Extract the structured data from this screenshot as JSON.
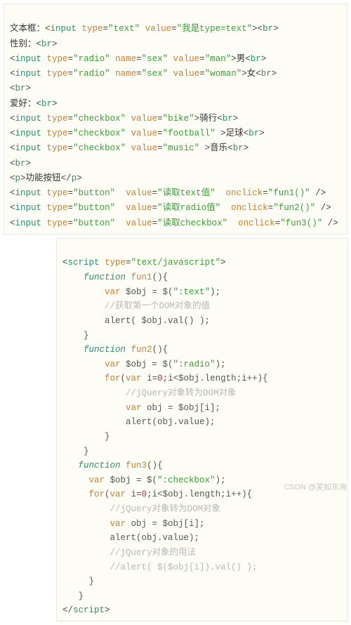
{
  "watermark": "CSDN @芙如东海",
  "b1": {
    "l01": {
      "t1": "文本框：",
      "p1": "<",
      "a1": "input ",
      "an1": "type",
      "eq1": "=",
      "av1": "\"text\"",
      "sp1": " ",
      "an2": "value",
      "eq2": "=",
      "av2": "\"我是type=text\"",
      "p2": "><",
      "a2": "br",
      "p3": ">"
    },
    "l02": {
      "t1": "性别：",
      "p1": "<",
      "a1": "br",
      "p2": ">"
    },
    "l03": {
      "p1": "<",
      "a1": "input ",
      "an1": "type",
      "eq1": "=",
      "av1": "\"radio\"",
      "sp1": " ",
      "an2": "name",
      "eq2": "=",
      "av2": "\"sex\"",
      "sp2": " ",
      "an3": "value",
      "eq3": "=",
      "av3": "\"man\"",
      "p2": ">",
      "t1": "男",
      "p3": "<",
      "a2": "br",
      "p4": ">"
    },
    "l04": {
      "p1": "<",
      "a1": "input ",
      "an1": "type",
      "eq1": "=",
      "av1": "\"radio\"",
      "sp1": " ",
      "an2": "name",
      "eq2": "=",
      "av2": "\"sex\"",
      "sp2": " ",
      "an3": "value",
      "eq3": "=",
      "av3": "\"woman\"",
      "p2": ">",
      "t1": "女",
      "p3": "<",
      "a2": "br",
      "p4": ">"
    },
    "l05": {
      "p1": "<",
      "a1": "br",
      "p2": ">"
    },
    "l06": {
      "t1": "爱好：",
      "p1": "<",
      "a1": "br",
      "p2": ">"
    },
    "l07": {
      "p1": "<",
      "a1": "input ",
      "an1": "type",
      "eq1": "=",
      "av1": "\"checkbox\"",
      "sp1": " ",
      "an2": "value",
      "eq2": "=",
      "av2": "\"bike\"",
      "p2": ">",
      "t1": "骑行",
      "p3": "<",
      "a2": "br",
      "p4": ">"
    },
    "l08": {
      "p1": "<",
      "a1": "input ",
      "an1": "type",
      "eq1": "=",
      "av1": "\"checkbox\"",
      "sp1": " ",
      "an2": "value",
      "eq2": "=",
      "av2": "\"football\"",
      "p2": " >",
      "t1": "足球",
      "p3": "<",
      "a2": "br",
      "p4": ">"
    },
    "l09": {
      "p1": "<",
      "a1": "input ",
      "an1": "type",
      "eq1": "=",
      "av1": "\"checkbox\"",
      "sp1": " ",
      "an2": "value",
      "eq2": "=",
      "av2": "\"music\"",
      "p2": " >",
      "t1": "音乐",
      "p3": "<",
      "a2": "br",
      "p4": ">"
    },
    "l10": {
      "p1": "<",
      "a1": "br",
      "p2": ">"
    },
    "l11": {
      "p1": "<",
      "a1": "p",
      "p2": ">",
      "t1": "功能按钮",
      "p3": "</",
      "a2": "p",
      "p4": ">"
    },
    "l12": {
      "p1": "<",
      "a1": "input ",
      "an1": "type",
      "eq1": "=",
      "av1": "\"button\"",
      "sp1": "  ",
      "an2": "value",
      "eq2": "=",
      "av2": "\"读取text值\"",
      "sp2": "  ",
      "an3": "onclick",
      "eq3": "=",
      "av3": "\"fun1()\"",
      "p2": " />"
    },
    "l13": {
      "p1": "<",
      "a1": "input ",
      "an1": "type",
      "eq1": "=",
      "av1": "\"button\"",
      "sp1": "  ",
      "an2": "value",
      "eq2": "=",
      "av2": "\"读取radio值\"",
      "sp2": "  ",
      "an3": "onclick",
      "eq3": "=",
      "av3": "\"fun2()\"",
      "p2": " />"
    },
    "l14": {
      "p1": "<",
      "a1": "input ",
      "an1": "type",
      "eq1": "=",
      "av1": "\"button\"",
      "sp1": "  ",
      "an2": "value",
      "eq2": "=",
      "av2": "\"读取checkbox\"",
      "sp2": "  ",
      "an3": "onclick",
      "eq3": "=",
      "av3": "\"fun3()\"",
      "p2": " />"
    }
  },
  "b2": {
    "l01": {
      "p1": "<",
      "a1": "script ",
      "an1": "type",
      "eq1": "=",
      "av1": "\"text/javascript\"",
      "p2": ">"
    },
    "l02": {
      "kw": "function",
      "sp": " ",
      "fn": "fun1",
      "rest": "(){"
    },
    "l03": {
      "kw": "var",
      "rest": " $obj = $(",
      "s": "\":text\"",
      "rest2": ");"
    },
    "l04": {
      "c": "//获取第一个DOM对象的值"
    },
    "l05": {
      "rest": "alert( $obj.val() );"
    },
    "l06": {
      "rest": "}"
    },
    "l07": {
      "kw": "function",
      "sp": " ",
      "fn": "fun2",
      "rest": "(){"
    },
    "l08": {
      "kw": "var",
      "rest": " $obj = $(",
      "s": "\":radio\"",
      "rest2": ");"
    },
    "l09": {
      "kw": "for",
      "rest1": "(",
      "kw2": "var",
      "rest2": " i=",
      "n": "0",
      "rest3": ";i<$obj.length;i++){"
    },
    "l10": {
      "c": "//jQuery对象转为DOM对象"
    },
    "l11": {
      "kw": "var",
      "rest": " obj = $obj[i];"
    },
    "l12": {
      "rest": "alert(obj.value);"
    },
    "l13": {
      "rest": "}"
    },
    "l14": {
      "rest": "}"
    },
    "l15": {
      "kw": "function",
      "sp": " ",
      "fn": "fun3",
      "rest": "(){"
    },
    "l16": {
      "kw": "var",
      "rest": " $obj = $(",
      "s": "\":checkbox\"",
      "rest2": ");"
    },
    "l17": {
      "kw": "for",
      "rest1": "(",
      "kw2": "var",
      "rest2": " i=",
      "n": "0",
      "rest3": ";i<$obj.length;i++){"
    },
    "l18": {
      "c": "//jQuery对象转为DOM对象"
    },
    "l19": {
      "kw": "var",
      "rest": " obj = $obj[i];"
    },
    "l20": {
      "rest": "alert(obj.value);"
    },
    "l21": {
      "c": "//jQuery对象的用法"
    },
    "l22": {
      "c": "//alert( $($obj[i]).val() );"
    },
    "l23": {
      "rest": "}"
    },
    "l24": {
      "rest": "}"
    },
    "l25": {
      "p1": "</",
      "a1": "script",
      "p2": ">"
    }
  }
}
